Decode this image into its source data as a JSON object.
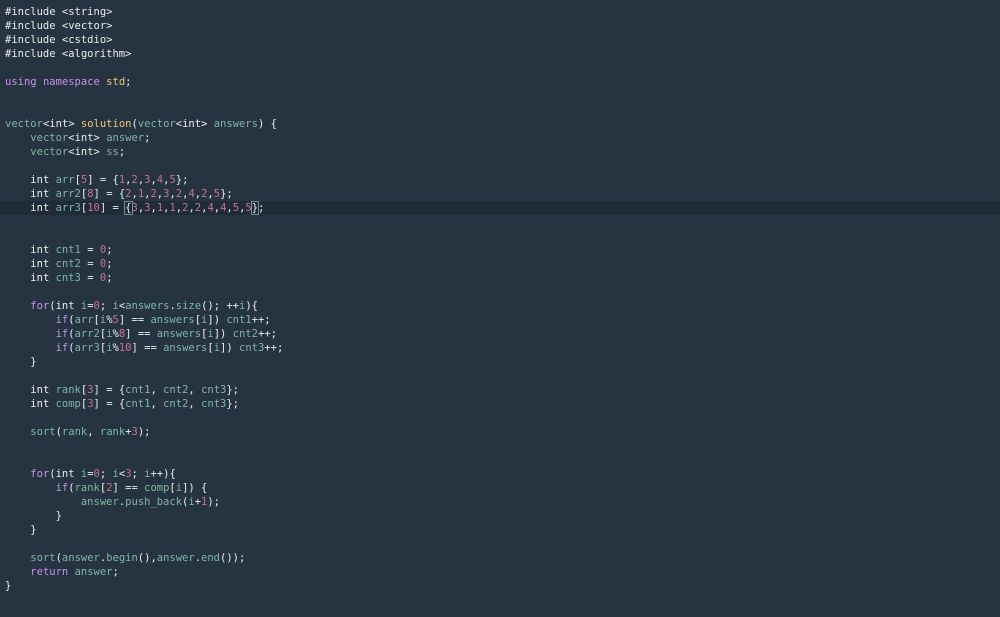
{
  "editor": {
    "current_line": 14,
    "colors": {
      "background": "#263442",
      "current_line": "#1f2b37",
      "keyword": "#c792ea",
      "type": "#7fb5a8",
      "function": "#f0c674",
      "number": "#c9738f",
      "plain": "#e9edf0"
    },
    "lines": [
      [
        [
          "prep",
          "#include <string>"
        ]
      ],
      [
        [
          "prep",
          "#include <vector>"
        ]
      ],
      [
        [
          "prep",
          "#include <cstdio>"
        ]
      ],
      [
        [
          "prep",
          "#include <algorithm>"
        ]
      ],
      [],
      [
        [
          "kw",
          "using"
        ],
        [
          "plain",
          " "
        ],
        [
          "kw",
          "namespace"
        ],
        [
          "plain",
          " "
        ],
        [
          "fn",
          "std"
        ],
        [
          "plain",
          ";"
        ]
      ],
      [],
      [],
      [
        [
          "type",
          "vector"
        ],
        [
          "plain",
          "<"
        ],
        [
          "plain",
          "int"
        ],
        [
          "plain",
          "> "
        ],
        [
          "fn",
          "solution"
        ],
        [
          "plain",
          "("
        ],
        [
          "type",
          "vector"
        ],
        [
          "plain",
          "<"
        ],
        [
          "plain",
          "int"
        ],
        [
          "plain",
          "> "
        ],
        [
          "var",
          "answers"
        ],
        [
          "plain",
          ") {"
        ]
      ],
      [
        [
          "plain",
          "    "
        ],
        [
          "type",
          "vector"
        ],
        [
          "plain",
          "<"
        ],
        [
          "plain",
          "int"
        ],
        [
          "plain",
          "> "
        ],
        [
          "var",
          "answer"
        ],
        [
          "plain",
          ";"
        ]
      ],
      [
        [
          "plain",
          "    "
        ],
        [
          "type",
          "vector"
        ],
        [
          "plain",
          "<"
        ],
        [
          "plain",
          "int"
        ],
        [
          "plain",
          "> "
        ],
        [
          "var",
          "ss"
        ],
        [
          "plain",
          ";"
        ]
      ],
      [],
      [
        [
          "plain",
          "    "
        ],
        [
          "plain",
          "int"
        ],
        [
          "plain",
          " "
        ],
        [
          "var",
          "arr"
        ],
        [
          "plain",
          "["
        ],
        [
          "num",
          "5"
        ],
        [
          "plain",
          "] = {"
        ],
        [
          "num",
          "1"
        ],
        [
          "plain",
          ","
        ],
        [
          "num",
          "2"
        ],
        [
          "plain",
          ","
        ],
        [
          "num",
          "3"
        ],
        [
          "plain",
          ","
        ],
        [
          "num",
          "4"
        ],
        [
          "plain",
          ","
        ],
        [
          "num",
          "5"
        ],
        [
          "plain",
          "};"
        ]
      ],
      [
        [
          "plain",
          "    "
        ],
        [
          "plain",
          "int"
        ],
        [
          "plain",
          " "
        ],
        [
          "var",
          "arr2"
        ],
        [
          "plain",
          "["
        ],
        [
          "num",
          "8"
        ],
        [
          "plain",
          "] = {"
        ],
        [
          "num",
          "2"
        ],
        [
          "plain",
          ","
        ],
        [
          "num",
          "1"
        ],
        [
          "plain",
          ","
        ],
        [
          "num",
          "2"
        ],
        [
          "plain",
          ","
        ],
        [
          "num",
          "3"
        ],
        [
          "plain",
          ","
        ],
        [
          "num",
          "2"
        ],
        [
          "plain",
          ","
        ],
        [
          "num",
          "4"
        ],
        [
          "plain",
          ","
        ],
        [
          "num",
          "2"
        ],
        [
          "plain",
          ","
        ],
        [
          "num",
          "5"
        ],
        [
          "plain",
          "};"
        ]
      ],
      [
        [
          "plain",
          "    "
        ],
        [
          "plain",
          "int"
        ],
        [
          "plain",
          " "
        ],
        [
          "var",
          "arr3"
        ],
        [
          "plain",
          "["
        ],
        [
          "num",
          "10"
        ],
        [
          "plain",
          "] = "
        ],
        [
          "cursor",
          "{"
        ],
        [
          "num",
          "3"
        ],
        [
          "plain",
          ","
        ],
        [
          "num",
          "3"
        ],
        [
          "plain",
          ","
        ],
        [
          "num",
          "1"
        ],
        [
          "plain",
          ","
        ],
        [
          "num",
          "1"
        ],
        [
          "plain",
          ","
        ],
        [
          "num",
          "2"
        ],
        [
          "plain",
          ","
        ],
        [
          "num",
          "2"
        ],
        [
          "plain",
          ","
        ],
        [
          "num",
          "4"
        ],
        [
          "plain",
          ","
        ],
        [
          "num",
          "4"
        ],
        [
          "plain",
          ","
        ],
        [
          "num",
          "5"
        ],
        [
          "plain",
          ","
        ],
        [
          "num",
          "5"
        ],
        [
          "cursor",
          "}"
        ],
        [
          "plain",
          ";"
        ]
      ],
      [],
      [],
      [
        [
          "plain",
          "    "
        ],
        [
          "plain",
          "int"
        ],
        [
          "plain",
          " "
        ],
        [
          "var",
          "cnt1"
        ],
        [
          "plain",
          " = "
        ],
        [
          "num",
          "0"
        ],
        [
          "plain",
          ";"
        ]
      ],
      [
        [
          "plain",
          "    "
        ],
        [
          "plain",
          "int"
        ],
        [
          "plain",
          " "
        ],
        [
          "var",
          "cnt2"
        ],
        [
          "plain",
          " = "
        ],
        [
          "num",
          "0"
        ],
        [
          "plain",
          ";"
        ]
      ],
      [
        [
          "plain",
          "    "
        ],
        [
          "plain",
          "int"
        ],
        [
          "plain",
          " "
        ],
        [
          "var",
          "cnt3"
        ],
        [
          "plain",
          " = "
        ],
        [
          "num",
          "0"
        ],
        [
          "plain",
          ";"
        ]
      ],
      [],
      [
        [
          "plain",
          "    "
        ],
        [
          "kw",
          "for"
        ],
        [
          "plain",
          "("
        ],
        [
          "plain",
          "int"
        ],
        [
          "plain",
          " "
        ],
        [
          "var",
          "i"
        ],
        [
          "plain",
          "="
        ],
        [
          "num",
          "0"
        ],
        [
          "plain",
          "; "
        ],
        [
          "var",
          "i"
        ],
        [
          "plain",
          "<"
        ],
        [
          "var",
          "answers"
        ],
        [
          "plain",
          "."
        ],
        [
          "var",
          "size"
        ],
        [
          "plain",
          "(); ++"
        ],
        [
          "var",
          "i"
        ],
        [
          "plain",
          "){"
        ]
      ],
      [
        [
          "plain",
          "        "
        ],
        [
          "kw",
          "if"
        ],
        [
          "plain",
          "("
        ],
        [
          "var",
          "arr"
        ],
        [
          "plain",
          "["
        ],
        [
          "var",
          "i"
        ],
        [
          "plain",
          "%"
        ],
        [
          "num",
          "5"
        ],
        [
          "plain",
          "] == "
        ],
        [
          "var",
          "answers"
        ],
        [
          "plain",
          "["
        ],
        [
          "var",
          "i"
        ],
        [
          "plain",
          "]) "
        ],
        [
          "var",
          "cnt1"
        ],
        [
          "plain",
          "++;"
        ]
      ],
      [
        [
          "plain",
          "        "
        ],
        [
          "kw",
          "if"
        ],
        [
          "plain",
          "("
        ],
        [
          "var",
          "arr2"
        ],
        [
          "plain",
          "["
        ],
        [
          "var",
          "i"
        ],
        [
          "plain",
          "%"
        ],
        [
          "num",
          "8"
        ],
        [
          "plain",
          "] == "
        ],
        [
          "var",
          "answers"
        ],
        [
          "plain",
          "["
        ],
        [
          "var",
          "i"
        ],
        [
          "plain",
          "]) "
        ],
        [
          "var",
          "cnt2"
        ],
        [
          "plain",
          "++;"
        ]
      ],
      [
        [
          "plain",
          "        "
        ],
        [
          "kw",
          "if"
        ],
        [
          "plain",
          "("
        ],
        [
          "var",
          "arr3"
        ],
        [
          "plain",
          "["
        ],
        [
          "var",
          "i"
        ],
        [
          "plain",
          "%"
        ],
        [
          "num",
          "10"
        ],
        [
          "plain",
          "] == "
        ],
        [
          "var",
          "answers"
        ],
        [
          "plain",
          "["
        ],
        [
          "var",
          "i"
        ],
        [
          "plain",
          "]) "
        ],
        [
          "var",
          "cnt3"
        ],
        [
          "plain",
          "++;"
        ]
      ],
      [
        [
          "plain",
          "    }"
        ]
      ],
      [],
      [
        [
          "plain",
          "    "
        ],
        [
          "plain",
          "int"
        ],
        [
          "plain",
          " "
        ],
        [
          "var",
          "rank"
        ],
        [
          "plain",
          "["
        ],
        [
          "num",
          "3"
        ],
        [
          "plain",
          "] = {"
        ],
        [
          "var",
          "cnt1"
        ],
        [
          "plain",
          ", "
        ],
        [
          "var",
          "cnt2"
        ],
        [
          "plain",
          ", "
        ],
        [
          "var",
          "cnt3"
        ],
        [
          "plain",
          "};"
        ]
      ],
      [
        [
          "plain",
          "    "
        ],
        [
          "plain",
          "int"
        ],
        [
          "plain",
          " "
        ],
        [
          "var",
          "comp"
        ],
        [
          "plain",
          "["
        ],
        [
          "num",
          "3"
        ],
        [
          "plain",
          "] = {"
        ],
        [
          "var",
          "cnt1"
        ],
        [
          "plain",
          ", "
        ],
        [
          "var",
          "cnt2"
        ],
        [
          "plain",
          ", "
        ],
        [
          "var",
          "cnt3"
        ],
        [
          "plain",
          "};"
        ]
      ],
      [],
      [
        [
          "plain",
          "    "
        ],
        [
          "var",
          "sort"
        ],
        [
          "plain",
          "("
        ],
        [
          "var",
          "rank"
        ],
        [
          "plain",
          ", "
        ],
        [
          "var",
          "rank"
        ],
        [
          "plain",
          "+"
        ],
        [
          "num",
          "3"
        ],
        [
          "plain",
          ");"
        ]
      ],
      [],
      [],
      [
        [
          "plain",
          "    "
        ],
        [
          "kw",
          "for"
        ],
        [
          "plain",
          "("
        ],
        [
          "plain",
          "int"
        ],
        [
          "plain",
          " "
        ],
        [
          "var",
          "i"
        ],
        [
          "plain",
          "="
        ],
        [
          "num",
          "0"
        ],
        [
          "plain",
          "; "
        ],
        [
          "var",
          "i"
        ],
        [
          "plain",
          "<"
        ],
        [
          "num",
          "3"
        ],
        [
          "plain",
          "; "
        ],
        [
          "var",
          "i"
        ],
        [
          "plain",
          "++){"
        ]
      ],
      [
        [
          "plain",
          "        "
        ],
        [
          "kw",
          "if"
        ],
        [
          "plain",
          "("
        ],
        [
          "var",
          "rank"
        ],
        [
          "plain",
          "["
        ],
        [
          "num",
          "2"
        ],
        [
          "plain",
          "] == "
        ],
        [
          "var",
          "comp"
        ],
        [
          "plain",
          "["
        ],
        [
          "var",
          "i"
        ],
        [
          "plain",
          "]) {"
        ]
      ],
      [
        [
          "plain",
          "            "
        ],
        [
          "var",
          "answer"
        ],
        [
          "plain",
          "."
        ],
        [
          "var",
          "push_back"
        ],
        [
          "plain",
          "("
        ],
        [
          "var",
          "i"
        ],
        [
          "plain",
          "+"
        ],
        [
          "num",
          "1"
        ],
        [
          "plain",
          ");"
        ]
      ],
      [
        [
          "plain",
          "        }"
        ]
      ],
      [
        [
          "plain",
          "    }"
        ]
      ],
      [],
      [
        [
          "plain",
          "    "
        ],
        [
          "var",
          "sort"
        ],
        [
          "plain",
          "("
        ],
        [
          "var",
          "answer"
        ],
        [
          "plain",
          "."
        ],
        [
          "var",
          "begin"
        ],
        [
          "plain",
          "(),"
        ],
        [
          "var",
          "answer"
        ],
        [
          "plain",
          "."
        ],
        [
          "var",
          "end"
        ],
        [
          "plain",
          "());"
        ]
      ],
      [
        [
          "plain",
          "    "
        ],
        [
          "kw",
          "return"
        ],
        [
          "plain",
          " "
        ],
        [
          "var",
          "answer"
        ],
        [
          "plain",
          ";"
        ]
      ],
      [
        [
          "plain",
          "}"
        ]
      ]
    ]
  }
}
